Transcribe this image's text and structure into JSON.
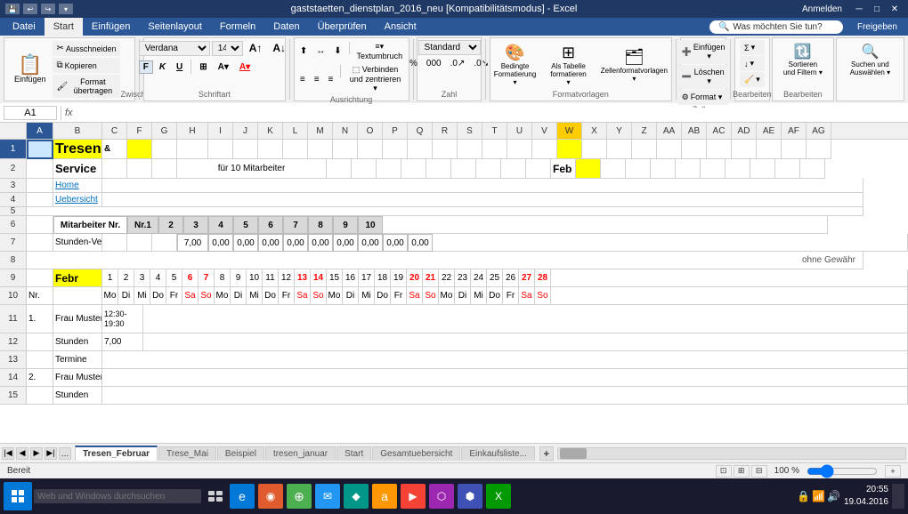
{
  "titlebar": {
    "title": "gaststaetten_dienstplan_2016_neu [Kompatibilitätsmodus] - Excel",
    "login": "Anmelden"
  },
  "ribbon": {
    "tabs": [
      "Datei",
      "Start",
      "Einfügen",
      "Seitenlayout",
      "Formeln",
      "Daten",
      "Überprüfen",
      "Ansicht"
    ],
    "active_tab": "Start",
    "font_name": "Verdana",
    "font_size": "14",
    "search_placeholder": "Was möchten Sie tun?",
    "freigeben": "Freigeben"
  },
  "formula_bar": {
    "name_box": "A1",
    "formula": ""
  },
  "sheet": {
    "col_headers": [
      "A",
      "B",
      "C",
      "F",
      "G",
      "H",
      "I",
      "J",
      "K",
      "L",
      "M",
      "N",
      "O",
      "P",
      "Q",
      "R",
      "S",
      "T",
      "U",
      "V",
      "W",
      "X",
      "Y",
      "Z",
      "AA",
      "AB",
      "AC",
      "AD",
      "AE",
      "AF",
      "AG"
    ],
    "rows": [
      {
        "num": 1,
        "cells": [
          {
            "text": "Tresen",
            "bg": "yellow",
            "bold": true,
            "size": "large"
          },
          {
            "text": "&",
            "bg": "white"
          },
          {
            "text": "",
            "bg": "yellow"
          }
        ]
      },
      {
        "num": 2,
        "cells": [
          {
            "text": "Service",
            "bold": true
          },
          {
            "text": ""
          },
          {
            "text": ""
          },
          {
            "text": "für 10 Mitarbeiter",
            "colspan": 10
          },
          {
            "text": "Feb",
            "bg": "yellow"
          }
        ]
      },
      {
        "num": 3,
        "cells": [
          {
            "text": "Home",
            "underline": true,
            "blue": true
          }
        ]
      },
      {
        "num": 4,
        "cells": [
          {
            "text": "Uebersicht",
            "underline": true,
            "blue": true
          }
        ]
      },
      {
        "num": 5,
        "cells": []
      },
      {
        "num": 6,
        "cells": [
          {
            "text": "Mitarbeiter Nr."
          },
          {
            "text": "Nr.1"
          },
          {
            "text": "2"
          },
          {
            "text": "3"
          },
          {
            "text": "4"
          },
          {
            "text": "5"
          },
          {
            "text": "6"
          },
          {
            "text": "7"
          },
          {
            "text": "8"
          },
          {
            "text": "9"
          },
          {
            "text": "10"
          }
        ]
      },
      {
        "num": 7,
        "cells": [
          {
            "text": ""
          },
          {
            "text": "7,00"
          },
          {
            "text": "0,00"
          },
          {
            "text": "0,00"
          },
          {
            "text": "0,00"
          },
          {
            "text": "0,00"
          },
          {
            "text": "0,00"
          },
          {
            "text": "0,00"
          },
          {
            "text": "0,00"
          },
          {
            "text": "0,00"
          },
          {
            "text": "0,00"
          }
        ]
      },
      {
        "num": 8,
        "cells": [
          {
            "text": "Stunden-Veranschlagung :"
          },
          {
            "text": "ohne Gewähr",
            "right": true
          }
        ]
      },
      {
        "num": 9,
        "cells": [
          {
            "text": "Febr",
            "bg": "yellow",
            "bold": true
          },
          {
            "text": "1"
          },
          {
            "text": "2"
          },
          {
            "text": "3"
          },
          {
            "text": "4"
          },
          {
            "text": "5"
          },
          {
            "text": "6",
            "red": true
          },
          {
            "text": "7",
            "red": true
          },
          {
            "text": "8"
          },
          {
            "text": "9"
          },
          {
            "text": "10"
          },
          {
            "text": "11"
          },
          {
            "text": "12"
          },
          {
            "text": "13",
            "red": true
          },
          {
            "text": "14",
            "red": true
          },
          {
            "text": "15"
          },
          {
            "text": "16"
          },
          {
            "text": "17"
          },
          {
            "text": "18"
          },
          {
            "text": "19"
          },
          {
            "text": "20",
            "red": true
          },
          {
            "text": "21",
            "red": true
          },
          {
            "text": "22"
          },
          {
            "text": "23"
          },
          {
            "text": "24"
          },
          {
            "text": "25"
          },
          {
            "text": "26"
          },
          {
            "text": "27",
            "red": true
          },
          {
            "text": "28",
            "red": true
          }
        ]
      },
      {
        "num": 10,
        "cells": [
          {
            "text": "Nr."
          },
          {
            "text": "Mo"
          },
          {
            "text": "Di"
          },
          {
            "text": "Mi"
          },
          {
            "text": "Do"
          },
          {
            "text": "Fr"
          },
          {
            "text": "Sa",
            "red": true
          },
          {
            "text": "So",
            "red": true
          },
          {
            "text": "Mo"
          },
          {
            "text": "Di"
          },
          {
            "text": "Mi"
          },
          {
            "text": "Do"
          },
          {
            "text": "Fr"
          },
          {
            "text": "Sa",
            "red": true
          },
          {
            "text": "So",
            "red": true
          },
          {
            "text": "Mo"
          },
          {
            "text": "Di"
          },
          {
            "text": "Mi"
          },
          {
            "text": "Do"
          },
          {
            "text": "Fr"
          },
          {
            "text": "Sa",
            "red": true
          },
          {
            "text": "So",
            "red": true
          },
          {
            "text": "Mo"
          },
          {
            "text": "Di"
          },
          {
            "text": "Mi"
          },
          {
            "text": "Do"
          },
          {
            "text": "Fr"
          },
          {
            "text": "Sa",
            "red": true
          },
          {
            "text": "So",
            "red": true
          }
        ]
      },
      {
        "num": 11,
        "cells": [
          {
            "text": "1."
          },
          {
            "text": "Frau Muster"
          },
          {
            "text": "12:30-\n19:30",
            "small": true
          }
        ]
      },
      {
        "num": 12,
        "cells": [
          {
            "text": ""
          },
          {
            "text": "Stunden"
          },
          {
            "text": "7,00"
          }
        ]
      },
      {
        "num": 13,
        "cells": [
          {
            "text": ""
          },
          {
            "text": "Termine"
          }
        ]
      },
      {
        "num": 14,
        "cells": [
          {
            "text": "2."
          },
          {
            "text": "Frau Muster"
          }
        ]
      },
      {
        "num": 15,
        "cells": [
          {
            "text": ""
          },
          {
            "text": "Stunden"
          }
        ]
      }
    ],
    "tabs": [
      "Tresen_Februar",
      "Trese_Mai",
      "Beispiel",
      "tresen_januar",
      "Start",
      "Gesamtuebersicht",
      "Einkaufsliste..."
    ],
    "active_tab": "Tresen_Februar"
  },
  "status": {
    "ready": "Bereit",
    "zoom": "100 %"
  },
  "taskbar": {
    "search_placeholder": "Web und Windows durchsuchen",
    "time": "20:55",
    "date": "19.04.2016"
  }
}
